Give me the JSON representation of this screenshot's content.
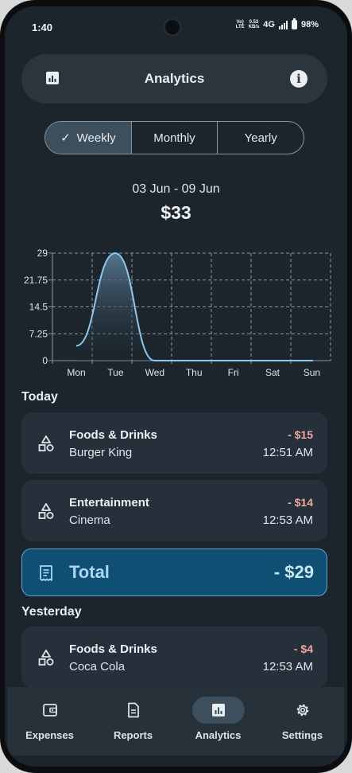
{
  "status_bar": {
    "time": "1:40",
    "volte": "Vo)\nLTE",
    "speed_value": "0.53",
    "speed_unit": "KB/s",
    "network": "4G",
    "battery": "98%"
  },
  "header": {
    "title": "Analytics",
    "left_icon": "bar-chart-icon",
    "right_icon": "info-icon"
  },
  "period_tabs": [
    {
      "label": "Weekly",
      "selected": true
    },
    {
      "label": "Monthly",
      "selected": false
    },
    {
      "label": "Yearly",
      "selected": false
    }
  ],
  "summary": {
    "date_range": "03 Jun - 09 Jun",
    "total": "$33"
  },
  "chart_data": {
    "type": "area",
    "categories": [
      "Mon",
      "Tue",
      "Wed",
      "Thu",
      "Fri",
      "Sat",
      "Sun"
    ],
    "values": [
      4,
      29,
      0,
      0,
      0,
      0,
      0
    ],
    "y_ticks": [
      "29",
      "21.75",
      "14.5",
      "7.25",
      "0"
    ],
    "ylim": [
      0,
      29
    ],
    "grid": true,
    "line_color": "#8ec8ee"
  },
  "sections": {
    "today": "Today",
    "yesterday": "Yesterday"
  },
  "transactions_today": [
    {
      "category": "Foods & Drinks",
      "merchant": "Burger King",
      "amount": "- $15",
      "time": "12:51 AM"
    },
    {
      "category": "Entertainment",
      "merchant": "Cinema",
      "amount": "- $14",
      "time": "12:53 AM"
    }
  ],
  "total_card": {
    "label": "Total",
    "value": "- $29"
  },
  "transactions_yesterday": [
    {
      "category": "Foods & Drinks",
      "merchant": "Coca Cola",
      "amount": "- $4",
      "time": "12:53 AM"
    }
  ],
  "bottom_nav": [
    {
      "label": "Expenses",
      "icon": "wallet-icon",
      "active": false
    },
    {
      "label": "Reports",
      "icon": "document-icon",
      "active": false
    },
    {
      "label": "Analytics",
      "icon": "bar-chart-icon",
      "active": true
    },
    {
      "label": "Settings",
      "icon": "gear-icon",
      "active": false
    }
  ],
  "colors": {
    "accent": "#0e4f73",
    "negative": "#f0a8a0",
    "background": "#1c252c",
    "card": "#25303a"
  }
}
